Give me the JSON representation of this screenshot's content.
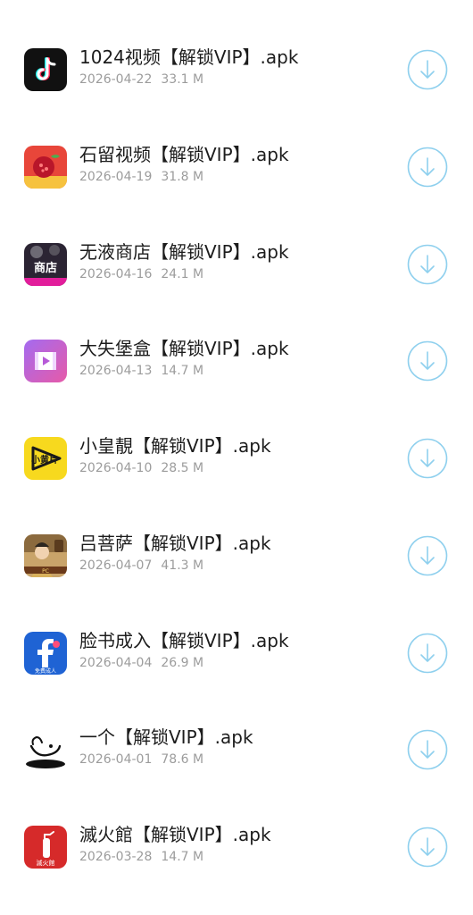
{
  "items": [
    {
      "name": "1024视频【解锁VIP】.apk",
      "date": "2026-04-22",
      "size": "33.1 M",
      "icon": "tiktok-style-icon"
    },
    {
      "name": "石留视频【解锁VIP】.apk",
      "date": "2026-04-19",
      "size": "31.8 M",
      "icon": "pomegranate-icon"
    },
    {
      "name": "无液商店【解锁VIP】.apk",
      "date": "2026-04-16",
      "size": "24.1 M",
      "icon": "shop-icon"
    },
    {
      "name": "大失堡盒【解锁VIP】.apk",
      "date": "2026-04-13",
      "size": "14.7 M",
      "icon": "video-player-icon"
    },
    {
      "name": "小皇靚【解锁VIP】.apk",
      "date": "2026-04-10",
      "size": "28.5 M",
      "icon": "yellow-play-icon"
    },
    {
      "name": "吕菩萨【解锁VIP】.apk",
      "date": "2026-04-07",
      "size": "41.3 M",
      "icon": "game-character-icon"
    },
    {
      "name": "脸书成入【解锁VIP】.apk",
      "date": "2026-04-04",
      "size": "26.9 M",
      "icon": "facebook-style-icon",
      "icon_caption": "免费成人"
    },
    {
      "name": "一个【解锁VIP】.apk",
      "date": "2026-04-01",
      "size": "78.6 M",
      "icon": "hand-bowl-icon"
    },
    {
      "name": "滅火館【解锁VIP】.apk",
      "date": "2026-03-28",
      "size": "14.7 M",
      "icon": "fire-extinguisher-icon",
      "icon_caption": "滅火館"
    }
  ],
  "colors": {
    "title": "#1c1c1c",
    "meta": "#9c9c9c",
    "download_accent": "#8fd0ee"
  },
  "download_icon": "download-arrow-icon"
}
